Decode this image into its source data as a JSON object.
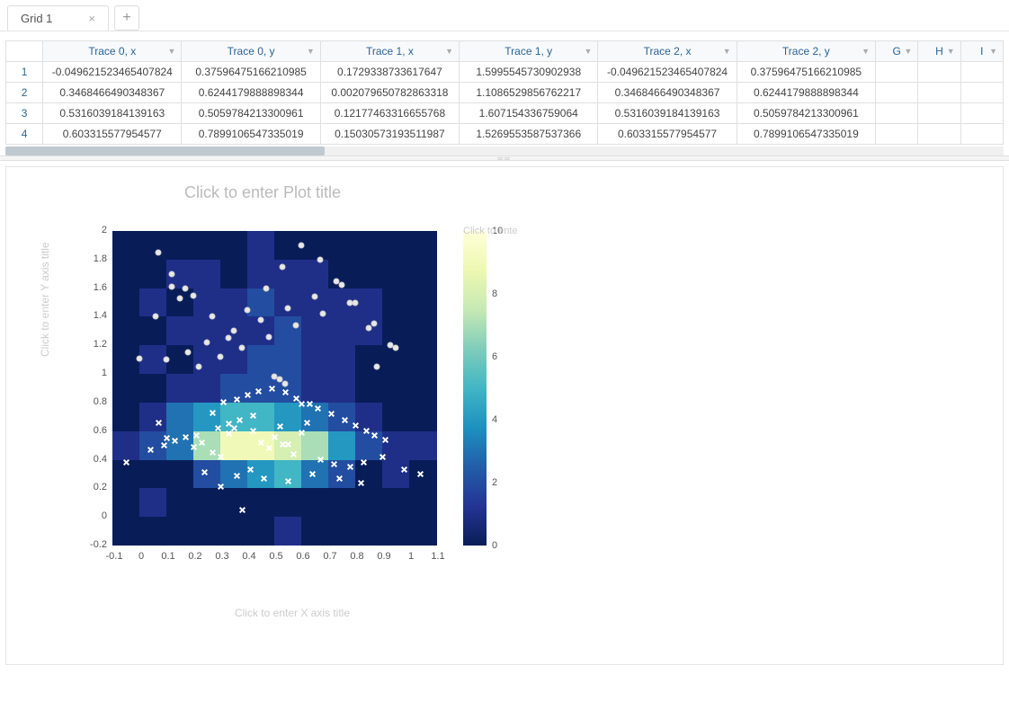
{
  "tabs": {
    "active": "Grid 1",
    "add_label": "+"
  },
  "grid": {
    "columns": [
      "Trace 0, x",
      "Trace 0, y",
      "Trace 1, x",
      "Trace 1, y",
      "Trace 2, x",
      "Trace 2, y",
      "G",
      "H",
      "I"
    ],
    "row_numbers": [
      "1",
      "2",
      "3",
      "4"
    ],
    "rows": [
      [
        "-0.049621523465407824",
        "0.37596475166210985",
        "0.1729338733617647",
        "1.5995545730902938",
        "-0.049621523465407824",
        "0.37596475166210985",
        "",
        "",
        ""
      ],
      [
        "0.3468466490348367",
        "0.6244179888898344",
        "0.002079650782863318",
        "1.1086529856762217",
        "0.3468466490348367",
        "0.6244179888898344",
        "",
        "",
        ""
      ],
      [
        "0.5316039184139163",
        "0.5059784213300961",
        "0.12177463316655768",
        "1.607154336759064",
        "0.5316039184139163",
        "0.5059784213300961",
        "",
        "",
        ""
      ],
      [
        "0.603315577954577",
        "0.7899106547335019",
        "0.15030573193511987",
        "1.5269553587537366",
        "0.603315577954577",
        "0.7899106547335019",
        "",
        "",
        ""
      ]
    ]
  },
  "plot": {
    "title_placeholder": "Click to enter Plot title",
    "xaxis_placeholder": "Click to enter X axis title",
    "yaxis_placeholder": "Click to enter Y axis title",
    "legend_placeholder": "Click to ente",
    "x_ticks": [
      "-0.1",
      "0",
      "0.1",
      "0.2",
      "0.3",
      "0.4",
      "0.5",
      "0.6",
      "0.7",
      "0.8",
      "0.9",
      "1",
      "1.1"
    ],
    "y_ticks": [
      "-0.2",
      "0",
      "0.2",
      "0.4",
      "0.6",
      "0.8",
      "1",
      "1.2",
      "1.4",
      "1.6",
      "1.8",
      "2"
    ],
    "colorbar_ticks": [
      "0",
      "2",
      "4",
      "6",
      "8",
      "10"
    ]
  },
  "chart_data": [
    {
      "type": "heatmap",
      "xlim": [
        -0.1,
        1.1
      ],
      "ylim": [
        -0.2,
        2.0
      ],
      "zlim": [
        0,
        10
      ],
      "x_centers": [
        -0.05,
        0.05,
        0.15,
        0.25,
        0.35,
        0.45,
        0.55,
        0.65,
        0.75,
        0.85,
        0.95,
        1.05
      ],
      "y_centers": [
        -0.1,
        0.1,
        0.3,
        0.5,
        0.7,
        0.9,
        1.1,
        1.3,
        1.5,
        1.7,
        1.9
      ],
      "z": [
        [
          0,
          0,
          0,
          0,
          0,
          0,
          1,
          0,
          0,
          0,
          0,
          0
        ],
        [
          0,
          1,
          0,
          0,
          0,
          0,
          0,
          0,
          0,
          0,
          0,
          0
        ],
        [
          0,
          0,
          0,
          2,
          3,
          4,
          5,
          3,
          2,
          0,
          1,
          0
        ],
        [
          1,
          2,
          3,
          7,
          9,
          9,
          8,
          7,
          4,
          2,
          1,
          1
        ],
        [
          0,
          1,
          3,
          4,
          5,
          5,
          4,
          3,
          2,
          1,
          0,
          0
        ],
        [
          0,
          0,
          1,
          1,
          2,
          2,
          2,
          1,
          1,
          0,
          0,
          0
        ],
        [
          0,
          1,
          0,
          1,
          1,
          2,
          2,
          1,
          1,
          0,
          0,
          0
        ],
        [
          0,
          0,
          1,
          1,
          1,
          1,
          2,
          1,
          1,
          1,
          0,
          0
        ],
        [
          0,
          1,
          0,
          1,
          1,
          2,
          1,
          1,
          1,
          1,
          0,
          0
        ],
        [
          0,
          0,
          1,
          1,
          0,
          1,
          1,
          1,
          0,
          0,
          0,
          0
        ],
        [
          0,
          0,
          0,
          0,
          0,
          1,
          0,
          0,
          0,
          0,
          0,
          0
        ]
      ],
      "colorscale": "YlGnBu_reversed"
    },
    {
      "type": "scatter",
      "name": "Trace 0 (crosses)",
      "marker": "x",
      "marker_color": "#ffffff",
      "x": [
        -0.05,
        0.35,
        0.53,
        0.6,
        0.1,
        0.21,
        0.33,
        0.42,
        0.45,
        0.48,
        0.5,
        0.52,
        0.55,
        0.57,
        0.6,
        0.62,
        0.42,
        0.27,
        0.31,
        0.36,
        0.4,
        0.44,
        0.49,
        0.54,
        0.58,
        0.63,
        0.66,
        0.71,
        0.76,
        0.8,
        0.84,
        0.87,
        0.91,
        0.04,
        0.09,
        0.13,
        0.17,
        0.2,
        0.23,
        0.27,
        0.3,
        0.29,
        0.33,
        0.37,
        0.41,
        0.67,
        0.72,
        0.78,
        0.83,
        0.9,
        0.98,
        1.04,
        0.07,
        0.24,
        0.36,
        0.46,
        0.55,
        0.64,
        0.74,
        0.82,
        0.3,
        0.38
      ],
      "y": [
        0.38,
        0.62,
        0.51,
        0.79,
        0.55,
        0.57,
        0.58,
        0.6,
        0.52,
        0.48,
        0.56,
        0.63,
        0.51,
        0.44,
        0.59,
        0.66,
        0.71,
        0.73,
        0.8,
        0.82,
        0.85,
        0.88,
        0.9,
        0.87,
        0.83,
        0.79,
        0.76,
        0.72,
        0.68,
        0.64,
        0.6,
        0.57,
        0.54,
        0.47,
        0.5,
        0.53,
        0.56,
        0.49,
        0.52,
        0.45,
        0.42,
        0.62,
        0.65,
        0.68,
        0.33,
        0.4,
        0.37,
        0.35,
        0.38,
        0.42,
        0.33,
        0.3,
        0.66,
        0.31,
        0.29,
        0.27,
        0.25,
        0.3,
        0.27,
        0.24,
        0.21,
        0.05
      ]
    },
    {
      "type": "scatter",
      "name": "Trace 1 (circles)",
      "marker": "o",
      "marker_color": "#e6e6e6",
      "x": [
        0.17,
        0.0,
        0.12,
        0.15,
        0.07,
        0.12,
        0.2,
        0.27,
        0.33,
        0.4,
        0.47,
        0.53,
        0.6,
        0.67,
        0.73,
        0.8,
        0.87,
        0.93,
        0.1,
        0.18,
        0.25,
        0.35,
        0.45,
        0.55,
        0.65,
        0.75,
        0.85,
        0.95,
        0.22,
        0.3,
        0.38,
        0.48,
        0.58,
        0.68,
        0.78,
        0.88,
        0.5,
        0.52,
        0.54,
        0.06
      ],
      "y": [
        1.6,
        1.11,
        1.61,
        1.53,
        1.85,
        1.7,
        1.55,
        1.4,
        1.25,
        1.45,
        1.6,
        1.75,
        1.9,
        1.8,
        1.65,
        1.5,
        1.35,
        1.2,
        1.1,
        1.15,
        1.22,
        1.3,
        1.38,
        1.46,
        1.54,
        1.62,
        1.32,
        1.18,
        1.05,
        1.12,
        1.18,
        1.26,
        1.34,
        1.42,
        1.5,
        1.05,
        0.98,
        0.96,
        0.93,
        1.4
      ]
    }
  ]
}
